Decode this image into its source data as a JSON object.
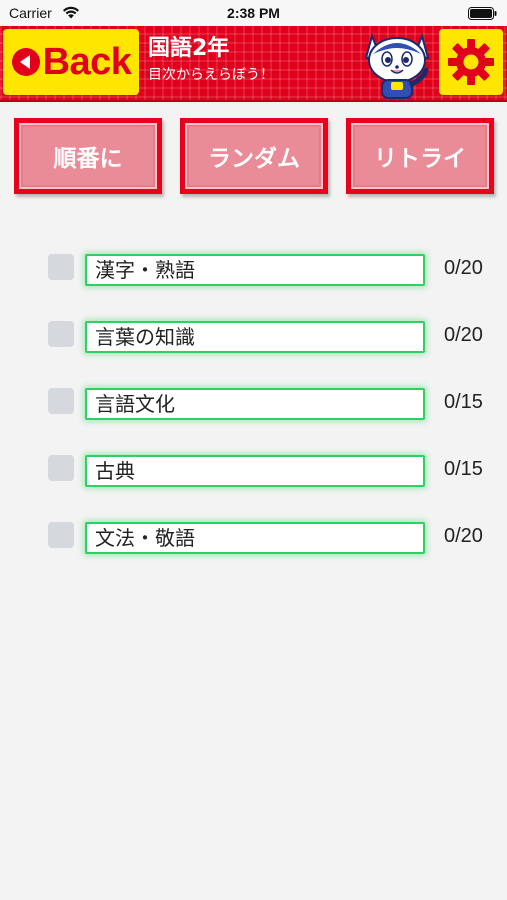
{
  "status_bar": {
    "carrier": "Carrier",
    "time": "2:38 PM"
  },
  "header": {
    "back_label": "Back",
    "title": "国語2年",
    "subtitle": "目次からえらぼう！"
  },
  "modes": [
    {
      "label": "順番に"
    },
    {
      "label": "ランダム"
    },
    {
      "label": "リトライ"
    }
  ],
  "items": [
    {
      "label": "漢字・熟語",
      "count": "0/20"
    },
    {
      "label": "言葉の知識",
      "count": "0/20"
    },
    {
      "label": "言語文化",
      "count": "0/15"
    },
    {
      "label": "古典",
      "count": "0/15"
    },
    {
      "label": "文法・敬語",
      "count": "0/20"
    }
  ],
  "colors": {
    "header_red": "#e0001b",
    "button_yellow": "#ffe600",
    "mode_pink": "#ea8c98",
    "field_border_green": "#2ecf63"
  },
  "icons": [
    "wifi-icon",
    "battery-icon",
    "back-arrow-icon",
    "mascot-cat",
    "gear-icon"
  ]
}
